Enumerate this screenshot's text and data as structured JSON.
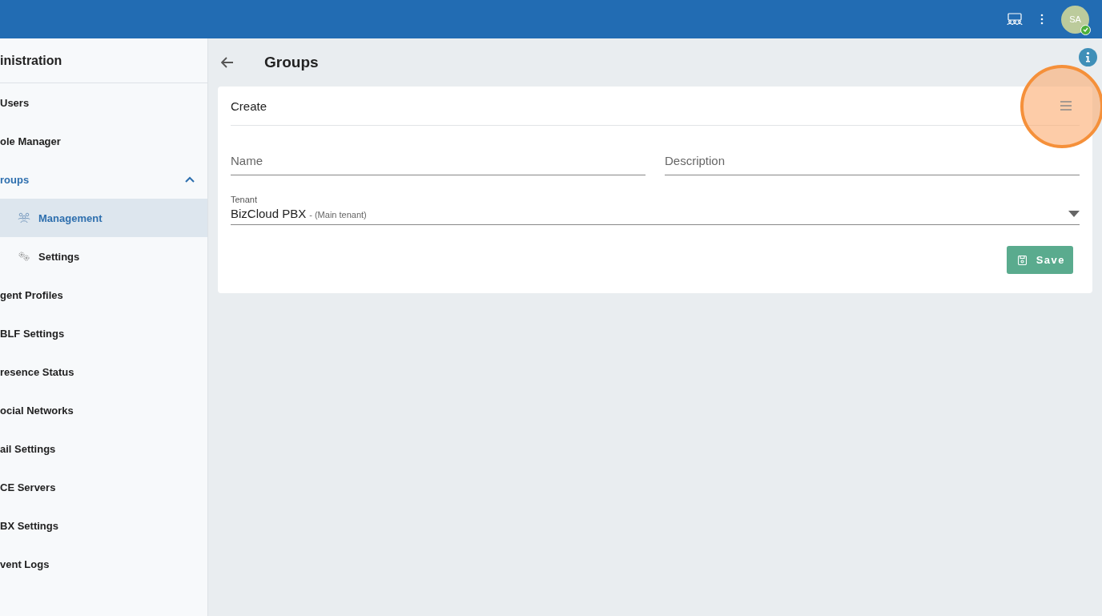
{
  "topbar": {
    "avatar": "SA",
    "online": true
  },
  "sidebar": {
    "title": "inistration",
    "items": [
      {
        "label": "Users",
        "selected": false
      },
      {
        "label": "ole Manager",
        "selected": false
      },
      {
        "label": "roups",
        "selected": true,
        "expanded": true,
        "children": [
          {
            "label": "Management",
            "kind": "people",
            "selected": true
          },
          {
            "label": "Settings",
            "kind": "gears",
            "selected": false
          }
        ]
      },
      {
        "label": "gent Profiles",
        "selected": false
      },
      {
        "label": "BLF Settings",
        "selected": false
      },
      {
        "label": "resence Status",
        "selected": false
      },
      {
        "label": "ocial Networks",
        "selected": false
      },
      {
        "label": "ail Settings",
        "selected": false
      },
      {
        "label": "CE Servers",
        "selected": false
      },
      {
        "label": "BX Settings",
        "selected": false
      },
      {
        "label": "vent Logs",
        "selected": false
      }
    ]
  },
  "page": {
    "title": "Groups"
  },
  "card": {
    "title": "Create",
    "fields": [
      {
        "placeholder": "Name"
      },
      {
        "placeholder": "Description"
      }
    ],
    "tenant": {
      "label": "Tenant",
      "value": "BizCloud PBX",
      "note": "- (Main tenant)"
    },
    "save_button": "Save"
  }
}
